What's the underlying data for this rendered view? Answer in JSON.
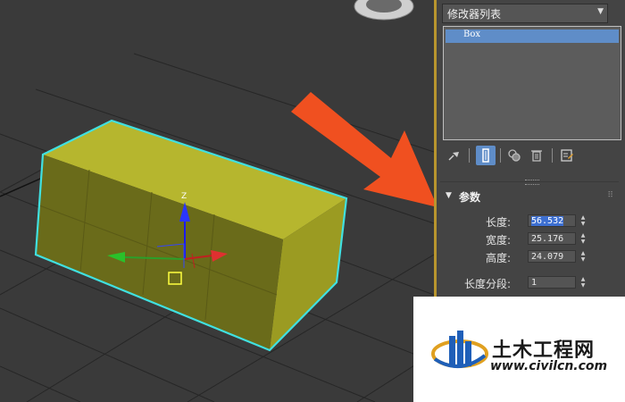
{
  "viewport": {
    "gizmo_axis_label": "Z"
  },
  "panel": {
    "modifier_list_label": "修改器列表",
    "modifier_stack": [
      {
        "label": "Box",
        "selected": true
      }
    ],
    "toolbar_icons": [
      "pin-stack-icon",
      "show-end-result-icon",
      "make-unique-icon",
      "remove-modifier-icon",
      "configure-modifier-sets-icon"
    ],
    "rollout": {
      "title": "参数",
      "params": [
        {
          "label": "长度:",
          "value": "56.532",
          "selected": true
        },
        {
          "label": "宽度:",
          "value": "25.176"
        },
        {
          "label": "高度:",
          "value": "24.079"
        },
        {
          "label": "长度分段:",
          "value": "1"
        }
      ]
    }
  },
  "watermark": {
    "brand": "土木工程网",
    "url": "www.civilcn.com"
  },
  "colors": {
    "box_fill": "#a0a020",
    "selection_edge": "#40e0e0",
    "arrow": "#f05020",
    "accent_blue": "#5f8dc8",
    "divider": "#b8952e"
  }
}
